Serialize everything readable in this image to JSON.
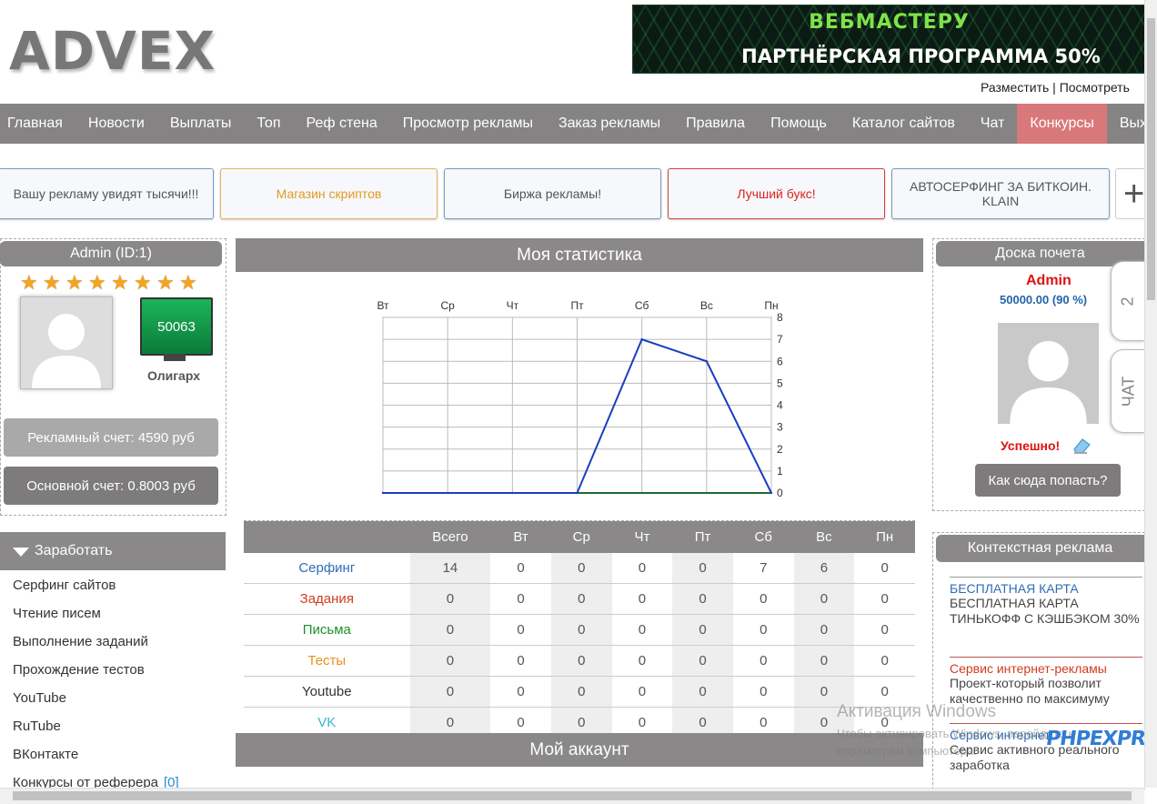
{
  "header": {
    "logo": "ADVEX",
    "banner": {
      "line1": "ВЕБМАСТЕРУ",
      "line2": "ПАРТНЁРСКАЯ ПРОГРАММА 50%"
    },
    "links": {
      "place": "Разместить",
      "sep": " | ",
      "view": "Посмотреть"
    }
  },
  "nav": [
    "Главная",
    "Новости",
    "Выплаты",
    "Топ",
    "Реф стена",
    "Просмотр рекламы",
    "Заказ рекламы",
    "Правила",
    "Помощь",
    "Каталог сайтов",
    "Чат",
    "Конкурсы",
    "Выход"
  ],
  "nav_active": "Конкурсы",
  "ad_boxes": [
    {
      "text": "Вашу рекламу увидят тысячи!!!",
      "color": "#555555",
      "border": "#7a9bbf"
    },
    {
      "text": "Магазин скриптов",
      "color": "#e59a23",
      "border": "#e7b35a"
    },
    {
      "text": "Биржа рекламы!",
      "color": "#555555",
      "border": "#7a9bbf"
    },
    {
      "text": "Лучший букс!",
      "color": "#e02020",
      "border": "#d64040"
    },
    {
      "text": "АВТОСЕРФИНГ ЗА БИТКОИН. KLAIN",
      "color": "#555555",
      "border": "#7a9bbf"
    }
  ],
  "ad_plus": "+",
  "user": {
    "name": "Admin (ID:1)",
    "stars": 8,
    "monitor_value": "50063",
    "rank": "Олигарх",
    "ad_account": "Рекламный счет: 4590 руб",
    "main_account": "Основной счет: 0.8003 руб"
  },
  "earn": {
    "title": "Заработать",
    "items": [
      "Серфинг сайтов",
      "Чтение писем",
      "Выполнение заданий",
      "Прохождение тестов",
      "YouTube",
      "RuTube",
      "ВКонтакте",
      "Конкурсы от реферера"
    ],
    "ref_badge": "[0]"
  },
  "stats": {
    "title": "Моя статистика",
    "account_title": "Мой аккаунт",
    "columns": [
      "",
      "Всего",
      "Вт",
      "Ср",
      "Чт",
      "Пт",
      "Сб",
      "Вс",
      "Пн"
    ],
    "rows": [
      {
        "label": "Серфинг",
        "color": "#2f6db5",
        "values": [
          "14",
          "0",
          "0",
          "0",
          "0",
          "7",
          "6",
          "0"
        ]
      },
      {
        "label": "Задания",
        "color": "#d23c1c",
        "values": [
          "0",
          "0",
          "0",
          "0",
          "0",
          "0",
          "0",
          "0"
        ]
      },
      {
        "label": "Письма",
        "color": "#1d8f2a",
        "values": [
          "0",
          "0",
          "0",
          "0",
          "0",
          "0",
          "0",
          "0"
        ]
      },
      {
        "label": "Тесты",
        "color": "#e8901c",
        "values": [
          "0",
          "0",
          "0",
          "0",
          "0",
          "0",
          "0",
          "0"
        ]
      },
      {
        "label": "Youtube",
        "color": "#333333",
        "values": [
          "0",
          "0",
          "0",
          "0",
          "0",
          "0",
          "0",
          "0"
        ]
      },
      {
        "label": "VK",
        "color": "#39b3d9",
        "values": [
          "0",
          "0",
          "0",
          "0",
          "0",
          "0",
          "0",
          "0"
        ]
      }
    ]
  },
  "chart_data": {
    "type": "line",
    "categories": [
      "Вт",
      "Ср",
      "Чт",
      "Пт",
      "Сб",
      "Вс",
      "Пн"
    ],
    "series": [
      {
        "values": [
          0,
          0,
          0,
          0,
          7,
          6,
          0
        ],
        "color": "#1a3fbf"
      }
    ],
    "ylim": [
      0,
      8
    ],
    "yticks": [
      "0",
      "1",
      "2",
      "3",
      "4",
      "5",
      "6",
      "7",
      "8"
    ],
    "grid": true
  },
  "honor": {
    "title": "Доска почета",
    "name": "Admin",
    "amount": "50000.00 (90 %)",
    "status": "Успешно!",
    "how_button": "Как сюда попасть?"
  },
  "side_tabs": [
    "2",
    "ЧАТ"
  ],
  "context": {
    "title": "Контекстная реклама",
    "items": [
      {
        "title": "БЕСПЛАТНАЯ КАРТА",
        "title_color": "#2f6db5",
        "text": "БЕСПЛАТНАЯ КАРТА ТИНЬКОФФ С КЭШБЭКОМ 30%"
      },
      {
        "title": "Сервис интернет-рекламы",
        "title_color": "#d23c1c",
        "text": "Проект-который позволит качественно по максимуму"
      },
      {
        "title": "Сервис интернет",
        "title_color": "#2f6db5",
        "text": "Сервис активного реального заработка"
      }
    ]
  },
  "watermark": {
    "line1": "Активация Windows",
    "line2": "Чтобы активировать Windows, перейдите к",
    "line3": "параметрам компьютера."
  },
  "stamp": "PHPEXPRESS"
}
